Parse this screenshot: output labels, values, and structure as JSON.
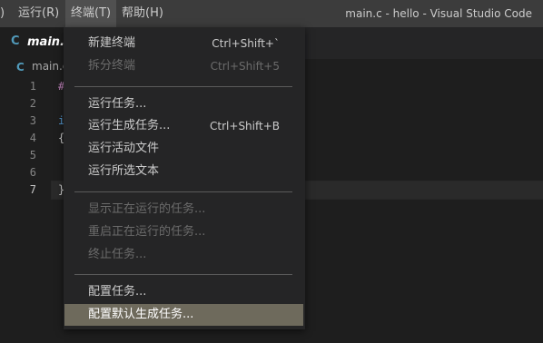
{
  "titlebar": {
    "menu": [
      {
        "label": ")"
      },
      {
        "label": "运行(R)"
      },
      {
        "label": "终端(T)"
      },
      {
        "label": "帮助(H)"
      }
    ],
    "window_title": "main.c - hello - Visual Studio Code"
  },
  "tab": {
    "icon": "c-language-icon",
    "icon_glyph": "C",
    "label": "main.c"
  },
  "breadcrumb": {
    "icon_glyph": "C",
    "label": "main.c"
  },
  "editor": {
    "lines": [
      {
        "num": "1",
        "text": "#"
      },
      {
        "num": "2",
        "text": ""
      },
      {
        "num": "3",
        "text": "i"
      },
      {
        "num": "4",
        "text": "{"
      },
      {
        "num": "5",
        "text": ""
      },
      {
        "num": "6",
        "text": ""
      },
      {
        "num": "7",
        "text": "}"
      }
    ],
    "current_line": "7"
  },
  "terminal_menu": {
    "items": [
      {
        "label": "新建终端",
        "shortcut": "Ctrl+Shift+`",
        "disabled": false
      },
      {
        "label": "拆分终端",
        "shortcut": "Ctrl+Shift+5",
        "disabled": true
      },
      {
        "label": "运行任务...",
        "shortcut": "",
        "disabled": false
      },
      {
        "label": "运行生成任务...",
        "shortcut": "Ctrl+Shift+B",
        "disabled": false
      },
      {
        "label": "运行活动文件",
        "shortcut": "",
        "disabled": false
      },
      {
        "label": "运行所选文本",
        "shortcut": "",
        "disabled": false
      },
      {
        "label": "显示正在运行的任务...",
        "shortcut": "",
        "disabled": true
      },
      {
        "label": "重启正在运行的任务...",
        "shortcut": "",
        "disabled": true
      },
      {
        "label": "终止任务...",
        "shortcut": "",
        "disabled": true
      },
      {
        "label": "配置任务...",
        "shortcut": "",
        "disabled": false
      },
      {
        "label": "配置默认生成任务...",
        "shortcut": "",
        "disabled": false,
        "highlighted": true
      }
    ]
  },
  "colors": {
    "titlebar_bg": "#3c3c3c",
    "menu_bg": "#252526",
    "highlight_bg": "#6e6a5c",
    "disabled_text": "#6b6b6b",
    "c_icon": "#519aba"
  }
}
